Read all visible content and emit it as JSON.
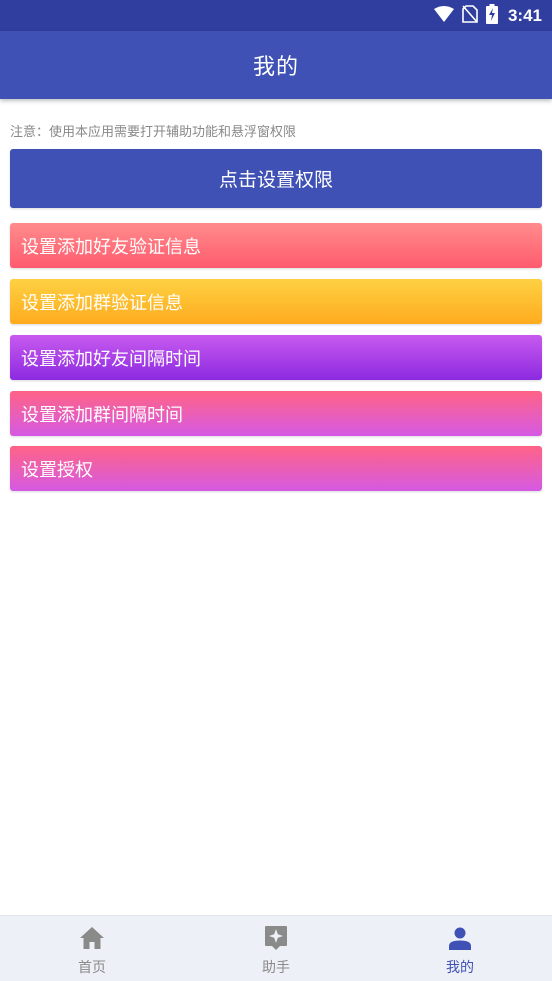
{
  "status_bar": {
    "time": "3:41",
    "icons": [
      "wifi-icon",
      "no-sim-icon",
      "battery-charging-icon"
    ]
  },
  "app_bar": {
    "title": "我的"
  },
  "notice": "注意：使用本应用需要打开辅助功能和悬浮窗权限",
  "primary_button": {
    "label": "点击设置权限",
    "color": "#3f51b5"
  },
  "menu": [
    {
      "label": "设置添加好友验证信息",
      "color": "#ff6b78"
    },
    {
      "label": "设置添加群验证信息",
      "color": "#ffbe2e"
    },
    {
      "label": "设置添加好友间隔时间",
      "color": "#a93de6"
    },
    {
      "label": "设置添加群间隔时间",
      "color": "#ec5fb6"
    },
    {
      "label": "设置授权",
      "color": "#ec5fb6"
    }
  ],
  "bottom_nav": [
    {
      "label": "首页",
      "icon": "home-icon",
      "active": false
    },
    {
      "label": "助手",
      "icon": "assistant-icon",
      "active": false
    },
    {
      "label": "我的",
      "icon": "person-icon",
      "active": true
    }
  ],
  "colors": {
    "status_bar": "#303f9f",
    "app_bar": "#3f51b5",
    "nav_active": "#3f51b5",
    "nav_inactive": "#8a8a8a"
  }
}
